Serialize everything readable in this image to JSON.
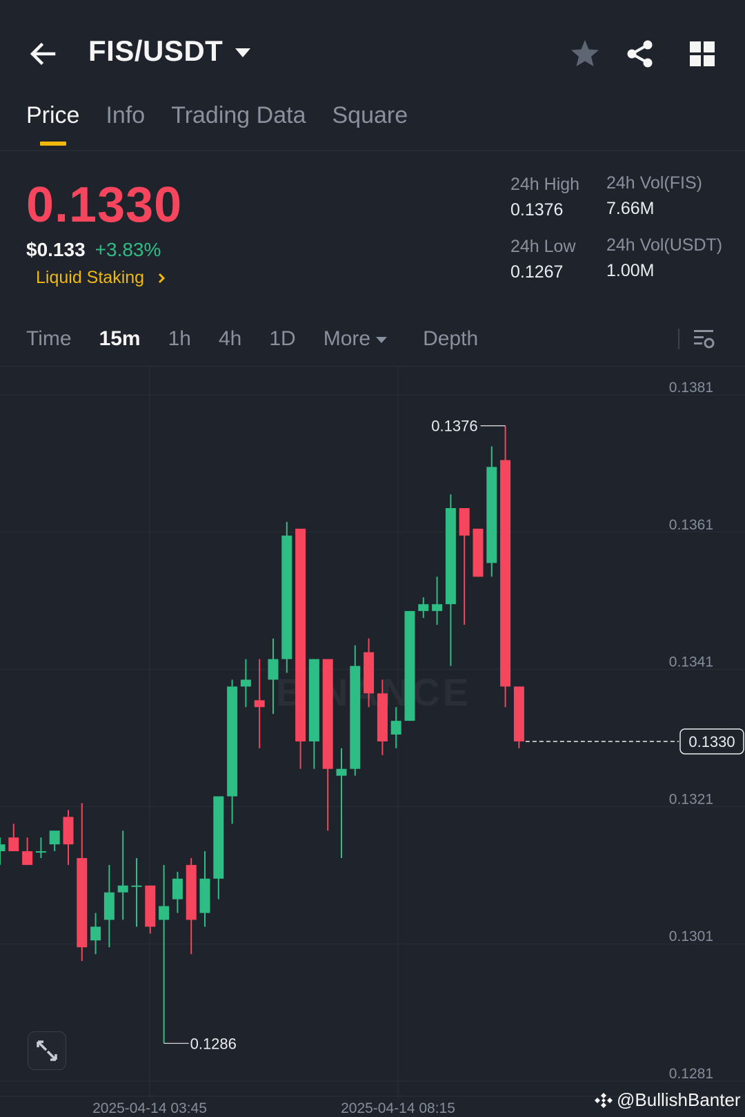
{
  "header": {
    "pair": "FIS/USDT",
    "icons": [
      "back-arrow-icon",
      "star-icon",
      "share-icon",
      "grid-icon"
    ]
  },
  "tabs": [
    {
      "label": "Price",
      "active": true
    },
    {
      "label": "Info",
      "active": false
    },
    {
      "label": "Trading Data",
      "active": false
    },
    {
      "label": "Square",
      "active": false
    }
  ],
  "ticker": {
    "last_price": "0.1330",
    "usd_price": "$0.133",
    "change_pct": "+3.83%",
    "category": "Liquid Staking",
    "high_label": "24h High",
    "high_value": "0.1376",
    "low_label": "24h Low",
    "low_value": "0.1267",
    "vol_base_label": "24h Vol(FIS)",
    "vol_base_value": "7.66M",
    "vol_quote_label": "24h Vol(USDT)",
    "vol_quote_value": "1.00M"
  },
  "intervals": {
    "items": [
      "Time",
      "15m",
      "1h",
      "4h",
      "1D",
      "More",
      "Depth"
    ],
    "active": "15m"
  },
  "colors": {
    "up": "#2ebd85",
    "down": "#f6465d",
    "accent": "#f0b90b",
    "background": "#1f232b"
  },
  "chart": {
    "price_ticks": [
      "0.1381",
      "0.1361",
      "0.1341",
      "0.1321",
      "0.1301",
      "0.1281"
    ],
    "time_ticks": [
      "2025-04-14 03:45",
      "2025-04-14 08:15"
    ],
    "current_price_label": "0.1330",
    "max_label": "0.1376",
    "min_label": "0.1286",
    "watermark_text": "BINANCE"
  },
  "chart_data": {
    "type": "candlestick",
    "interval": "15m",
    "ylim": [
      0.1281,
      0.1381
    ],
    "candles": [
      {
        "o": 0.13145,
        "h": 0.13165,
        "l": 0.13125,
        "c": 0.13155
      },
      {
        "o": 0.13165,
        "h": 0.13185,
        "l": 0.13145,
        "c": 0.13145
      },
      {
        "o": 0.13145,
        "h": 0.13165,
        "l": 0.13125,
        "c": 0.13125
      },
      {
        "o": 0.13145,
        "h": 0.13165,
        "l": 0.13135,
        "c": 0.13145
      },
      {
        "o": 0.13155,
        "h": 0.13175,
        "l": 0.13145,
        "c": 0.13175
      },
      {
        "o": 0.13195,
        "h": 0.13205,
        "l": 0.13125,
        "c": 0.13155
      },
      {
        "o": 0.13135,
        "h": 0.13215,
        "l": 0.12985,
        "c": 0.13005
      },
      {
        "o": 0.13015,
        "h": 0.13055,
        "l": 0.12995,
        "c": 0.13035
      },
      {
        "o": 0.13045,
        "h": 0.13125,
        "l": 0.13005,
        "c": 0.13085
      },
      {
        "o": 0.13085,
        "h": 0.13175,
        "l": 0.13045,
        "c": 0.13095
      },
      {
        "o": 0.13095,
        "h": 0.13135,
        "l": 0.13035,
        "c": 0.13095
      },
      {
        "o": 0.13095,
        "h": 0.13095,
        "l": 0.13025,
        "c": 0.13035
      },
      {
        "o": 0.13045,
        "h": 0.13125,
        "l": 0.12865,
        "c": 0.13065
      },
      {
        "o": 0.13075,
        "h": 0.13115,
        "l": 0.13055,
        "c": 0.13105
      },
      {
        "o": 0.13125,
        "h": 0.13135,
        "l": 0.12995,
        "c": 0.13045
      },
      {
        "o": 0.13055,
        "h": 0.13145,
        "l": 0.13035,
        "c": 0.13105
      },
      {
        "o": 0.13105,
        "h": 0.13215,
        "l": 0.13075,
        "c": 0.13225
      },
      {
        "o": 0.13225,
        "h": 0.13395,
        "l": 0.13185,
        "c": 0.13385
      },
      {
        "o": 0.13385,
        "h": 0.13425,
        "l": 0.13355,
        "c": 0.13395
      },
      {
        "o": 0.13365,
        "h": 0.13425,
        "l": 0.13295,
        "c": 0.13355
      },
      {
        "o": 0.13395,
        "h": 0.13455,
        "l": 0.13345,
        "c": 0.13425
      },
      {
        "o": 0.13425,
        "h": 0.13625,
        "l": 0.13405,
        "c": 0.13605
      },
      {
        "o": 0.13615,
        "h": 0.13615,
        "l": 0.13265,
        "c": 0.13305
      },
      {
        "o": 0.13305,
        "h": 0.13425,
        "l": 0.13265,
        "c": 0.13425
      },
      {
        "o": 0.13425,
        "h": 0.13415,
        "l": 0.13175,
        "c": 0.13265
      },
      {
        "o": 0.13255,
        "h": 0.13295,
        "l": 0.13135,
        "c": 0.13265
      },
      {
        "o": 0.13265,
        "h": 0.13445,
        "l": 0.13255,
        "c": 0.13415
      },
      {
        "o": 0.13435,
        "h": 0.13455,
        "l": 0.13355,
        "c": 0.13375
      },
      {
        "o": 0.13375,
        "h": 0.13395,
        "l": 0.13285,
        "c": 0.13305
      },
      {
        "o": 0.13315,
        "h": 0.13355,
        "l": 0.13295,
        "c": 0.13335
      },
      {
        "o": 0.13335,
        "h": 0.13495,
        "l": 0.13335,
        "c": 0.13495
      },
      {
        "o": 0.13495,
        "h": 0.13515,
        "l": 0.13485,
        "c": 0.13505
      },
      {
        "o": 0.13495,
        "h": 0.13545,
        "l": 0.13475,
        "c": 0.13505
      },
      {
        "o": 0.13505,
        "h": 0.13665,
        "l": 0.13415,
        "c": 0.13645
      },
      {
        "o": 0.13645,
        "h": 0.13645,
        "l": 0.13475,
        "c": 0.13605
      },
      {
        "o": 0.13615,
        "h": 0.13615,
        "l": 0.13545,
        "c": 0.13545
      },
      {
        "o": 0.13565,
        "h": 0.13735,
        "l": 0.13545,
        "c": 0.13705
      },
      {
        "o": 0.13715,
        "h": 0.13765,
        "l": 0.13355,
        "c": 0.13385
      },
      {
        "o": 0.13385,
        "h": 0.13385,
        "l": 0.13295,
        "c": 0.13305
      }
    ]
  }
}
